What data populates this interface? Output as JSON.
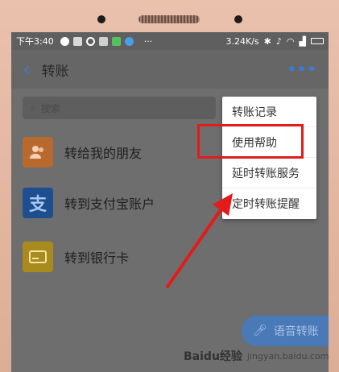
{
  "status_bar": {
    "time": "下午3:40",
    "speed": "3.24K/s",
    "icons": [
      "chat-bubble-icon",
      "camera-icon",
      "circle-icon",
      "image-icon",
      "app-icon-green",
      "app-icon-blue",
      "more-dots-icon",
      "bluetooth-icon",
      "silent-icon",
      "wifi-icon",
      "signal-icon",
      "battery-icon"
    ]
  },
  "header": {
    "title": "转账",
    "back_icon": "chevron-left-icon",
    "more_icon": "more-dots-icon"
  },
  "search": {
    "placeholder": "搜索"
  },
  "list": [
    {
      "label": "转给我的朋友",
      "icon": "contacts-icon",
      "color": "#e07a2d"
    },
    {
      "label": "转到支付宝账户",
      "icon": "alipay-icon",
      "color": "#1e62b8"
    },
    {
      "label": "转到银行卡",
      "icon": "bank-card-icon",
      "color": "#d4a820"
    }
  ],
  "menu": {
    "items": [
      "转账记录",
      "使用帮助",
      "延时转账服务",
      "定时转账提醒"
    ],
    "highlighted_index": 2,
    "highlight_color": "#e21b1b"
  },
  "fab": {
    "label": "语音转账",
    "icon": "microphone-icon"
  },
  "watermark": {
    "brand": "Baidu经验",
    "url": "jingyan.baidu.com"
  },
  "colors": {
    "accent": "#3d7ad6",
    "annotation": "#e21b1b"
  }
}
